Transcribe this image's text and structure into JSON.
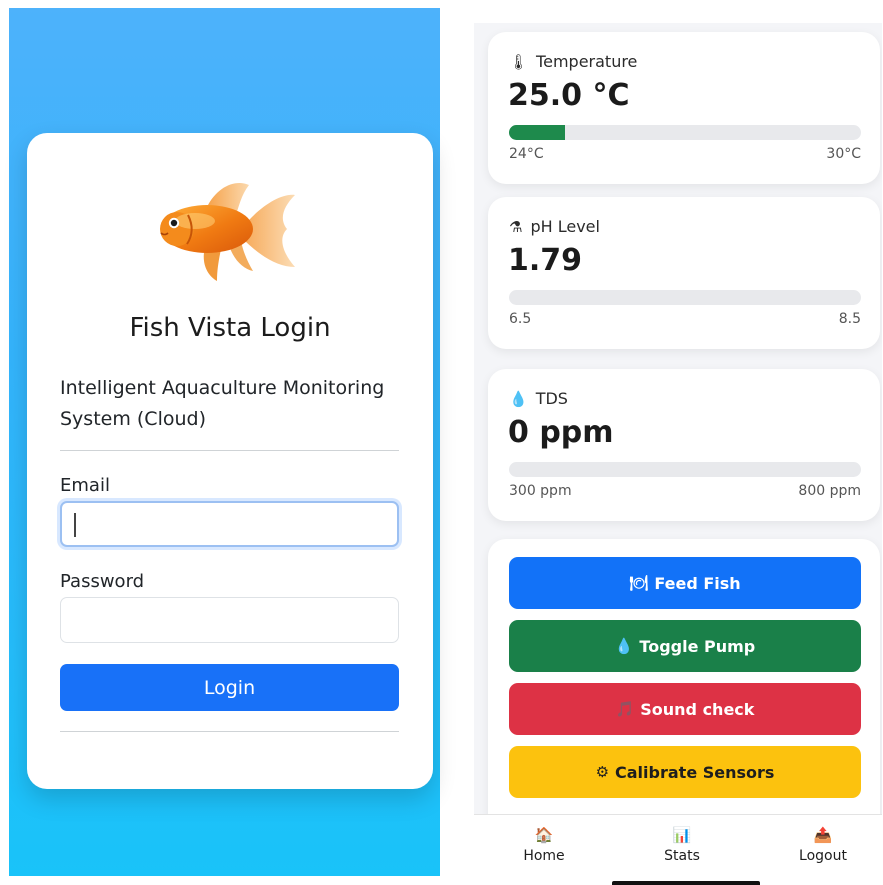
{
  "login": {
    "title": "Fish Vista Login",
    "subtitle": "Intelligent Aquaculture Monitoring System (Cloud)",
    "email_label": "Email",
    "email_value": "",
    "password_label": "Password",
    "password_value": "",
    "login_button": "Login",
    "logo_icon": "goldfish-logo"
  },
  "sensors": {
    "temperature": {
      "icon": "thermometer-icon",
      "icon_glyph": "🌡",
      "label": "Temperature",
      "value": "25.0 °C",
      "min": "24°C",
      "max": "30°C",
      "progress": 0.16,
      "bar_color": "#1e8a4c"
    },
    "ph": {
      "icon": "flask-icon",
      "icon_glyph": "⚗",
      "label": "pH Level",
      "value": "1.79",
      "min": "6.5",
      "max": "8.5",
      "progress": 0
    },
    "tds": {
      "icon": "water-drop-icon",
      "icon_glyph": "💧",
      "label": "TDS",
      "value": "0 ppm",
      "min": "300 ppm",
      "max": "800 ppm",
      "progress": 0
    }
  },
  "controls": {
    "feed": {
      "icon": "plate-icon",
      "icon_glyph": "🍽",
      "label": "Feed Fish",
      "color": "#1272f8"
    },
    "pump": {
      "icon": "water-drop-icon",
      "icon_glyph": "💧",
      "label": "Toggle Pump",
      "color": "#1a8049"
    },
    "sound": {
      "icon": "music-note-icon",
      "icon_glyph": "🎵",
      "label": "Sound check",
      "color": "#dd3245"
    },
    "calibrate": {
      "icon": "gear-icon",
      "icon_glyph": "⚙",
      "label": "Calibrate Sensors",
      "color": "#fcc20e"
    }
  },
  "nav": {
    "home": {
      "icon": "house-icon",
      "icon_glyph": "🏠",
      "label": "Home"
    },
    "stats": {
      "icon": "bar-chart-icon",
      "icon_glyph": "📊",
      "label": "Stats"
    },
    "logout": {
      "icon": "logout-icon",
      "icon_glyph": "📤",
      "label": "Logout"
    }
  }
}
